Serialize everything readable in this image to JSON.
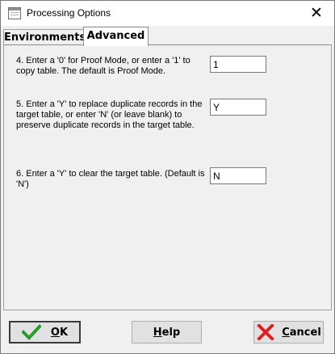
{
  "window": {
    "title": "Processing Options",
    "close_glyph": "✕"
  },
  "tabs": [
    {
      "label": "Environments",
      "active": false
    },
    {
      "label": "Advanced",
      "active": true
    }
  ],
  "options": [
    {
      "text": "4. Enter a '0' for Proof Mode, or enter a '1' to copy table. The default is Proof Mode.",
      "value": "1"
    },
    {
      "text": "5. Enter a 'Y' to replace duplicate records in the target table, or enter 'N' (or leave blank) to preserve duplicate records in the target table.",
      "value": "Y"
    },
    {
      "text": "6. Enter a 'Y' to clear the target table. (Default is 'N')",
      "value": "N"
    }
  ],
  "buttons": {
    "ok": {
      "label": "OK",
      "icon": "checkmark-icon"
    },
    "help": {
      "label": "Help"
    },
    "cancel": {
      "label": "Cancel",
      "icon": "x-cross-icon"
    }
  },
  "colors": {
    "ok_check": "#2e9a2e",
    "cancel_x": "#e02020"
  }
}
